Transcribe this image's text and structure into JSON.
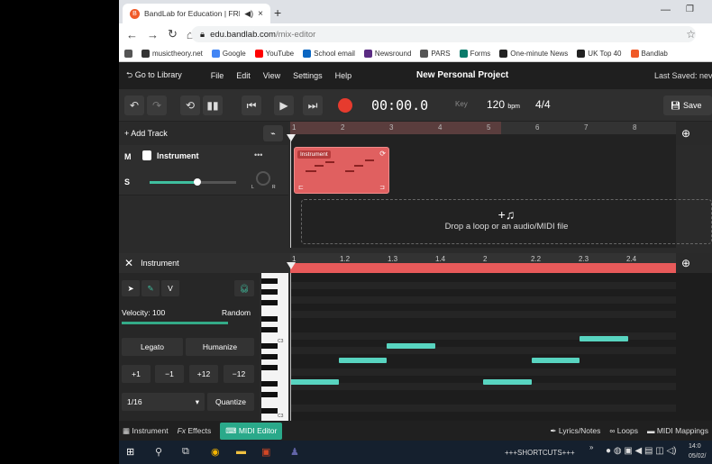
{
  "browser": {
    "tab_title": "BandLab for Education | FRE",
    "tab_audio": "◀)",
    "tab_close": "×",
    "new_tab": "+",
    "url_host": "edu.bandlab.com",
    "url_path": "/mix-editor",
    "bookmarks": [
      {
        "label": "musictheory.net",
        "color": "#333333"
      },
      {
        "label": "Google",
        "color": "#4285f4"
      },
      {
        "label": "YouTube",
        "color": "#ff0000"
      },
      {
        "label": "School email",
        "color": "#0a66c2"
      },
      {
        "label": "Newsround",
        "color": "#5b2c83"
      },
      {
        "label": "PARS",
        "color": "#555555"
      },
      {
        "label": "Forms",
        "color": "#0b7b6b"
      },
      {
        "label": "One-minute News",
        "color": "#222222"
      },
      {
        "label": "UK Top 40",
        "color": "#222222"
      },
      {
        "label": "Bandlab",
        "color": "#f05a28"
      }
    ]
  },
  "menubar": {
    "go_to_library": "Go to Library",
    "items": [
      "File",
      "Edit",
      "View",
      "Settings",
      "Help"
    ],
    "project_title": "New Personal Project",
    "last_saved": "Last Saved: neve"
  },
  "transport": {
    "time": "00:00.0",
    "key_label": "Key",
    "tempo": "120",
    "tempo_unit": "bpm",
    "time_signature": "4/4",
    "save_label": "Save"
  },
  "tracks": {
    "add_track": "+ Add Track",
    "ruler": [
      "1",
      "2",
      "3",
      "4",
      "5",
      "6",
      "7",
      "8"
    ],
    "track_name": "Instrument",
    "mute": "M",
    "solo": "S",
    "pan_left": "L",
    "pan_right": "R",
    "volume": 0.55,
    "more": "•••",
    "region_label": "Instrument",
    "drop_text": "Drop a loop or an audio/MIDI file"
  },
  "midi": {
    "header": "Instrument",
    "ruler": [
      "1",
      "1.2",
      "1.3",
      "1.4",
      "2",
      "2.2",
      "2.3",
      "2.4"
    ],
    "tool_v": "V",
    "velocity_label": "Velocity: 100",
    "random": "Random",
    "legato": "Legato",
    "humanize": "Humanize",
    "transpose": [
      "+1",
      "−1",
      "+12",
      "−12"
    ],
    "grid_value": "1/16",
    "grid_arrow": "▾",
    "quantize": "Quantize",
    "key_label_c": "C3",
    "notes": [
      {
        "start": 0.0,
        "length": 0.125,
        "row": 14
      },
      {
        "start": 0.125,
        "length": 0.125,
        "row": 11
      },
      {
        "start": 0.25,
        "length": 0.125,
        "row": 9
      },
      {
        "start": 0.5,
        "length": 0.125,
        "row": 14
      },
      {
        "start": 0.625,
        "length": 0.125,
        "row": 11
      },
      {
        "start": 0.75,
        "length": 0.125,
        "row": 8
      }
    ]
  },
  "bottombar": {
    "instrument": "Instrument",
    "effects": "Effects",
    "midi_editor": "MIDI Editor",
    "lyrics": "Lyrics/Notes",
    "loops": "Loops",
    "midi_mappings": "MIDI Mappings"
  },
  "taskbar": {
    "shortcuts": "+++SHORTCUTS+++",
    "time": "14:0",
    "date": "05/02/"
  }
}
